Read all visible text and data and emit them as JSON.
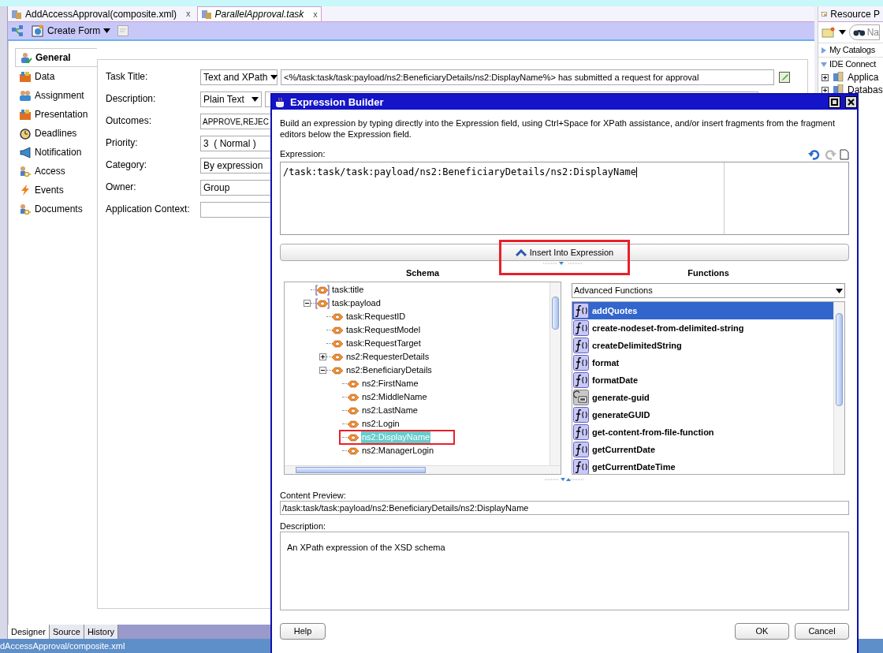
{
  "editor_tabs": [
    {
      "label": "AddAccessApproval(composite.xml)",
      "selected": false,
      "close": "x"
    },
    {
      "label": "ParallelApproval.task",
      "selected": true,
      "close": "x"
    }
  ],
  "toolbar": {
    "create_form": "Create Form"
  },
  "nav": [
    {
      "label": "General",
      "selected": true
    },
    {
      "label": "Data",
      "selected": false
    },
    {
      "label": "Assignment",
      "selected": false
    },
    {
      "label": "Presentation",
      "selected": false
    },
    {
      "label": "Deadlines",
      "selected": false
    },
    {
      "label": "Notification",
      "selected": false
    },
    {
      "label": "Access",
      "selected": false
    },
    {
      "label": "Events",
      "selected": false
    },
    {
      "label": "Documents",
      "selected": false
    }
  ],
  "form": [
    {
      "label": "Task Title:",
      "kind": "select-text",
      "option": "Text and XPath",
      "value": "<%/task:task/task:payload/ns2:BeneficiaryDetails/ns2:DisplayName%> has submitted a request for approval"
    },
    {
      "label": "Description:",
      "kind": "select-text",
      "option": "Plain Text"
    },
    {
      "label": "Outcomes:",
      "kind": "text",
      "value": "APPROVE,REJEC"
    },
    {
      "label": "Priority:",
      "kind": "select",
      "option": "3  ( Normal )"
    },
    {
      "label": "Category:",
      "kind": "select",
      "option": "By expression"
    },
    {
      "label": "Owner:",
      "kind": "select",
      "option": "Group"
    },
    {
      "label": "Application Context:",
      "kind": "text"
    }
  ],
  "bottom_tabs": [
    {
      "label": "Designer",
      "selected": true
    },
    {
      "label": "Source",
      "selected": false
    },
    {
      "label": "History",
      "selected": false
    }
  ],
  "status_bar": "dAccessApproval/composite.xml",
  "resource_panel": {
    "title": "Resource P",
    "search_placeholder": "Na",
    "sections": [
      {
        "label": "My Catalogs",
        "expanded": false
      },
      {
        "label": "IDE Connect",
        "expanded": true,
        "items": [
          "Applica",
          "Databas"
        ]
      }
    ]
  },
  "dialog": {
    "title": "Expression Builder",
    "intro": "Build an expression by typing directly into the Expression field, using Ctrl+Space for XPath assistance, and/or insert fragments from the fragment editors below the Expression field.",
    "expression_label": "Expression:",
    "expression": "/task:task/task:payload/ns2:BeneficiaryDetails/ns2:DisplayName",
    "insert_button": "Insert Into Expression",
    "schema_heading": "Schema",
    "tree": [
      {
        "label": "task:title",
        "kind": "group",
        "selected": false
      },
      {
        "label": "task:payload",
        "kind": "group",
        "selected": false,
        "expanded": true,
        "children": [
          {
            "label": "task:RequestID",
            "kind": "element",
            "selected": false
          },
          {
            "label": "task:RequestModel",
            "kind": "element",
            "selected": false
          },
          {
            "label": "task:RequestTarget",
            "kind": "element",
            "selected": false
          },
          {
            "label": "ns2:RequesterDetails",
            "kind": "element",
            "selected": false,
            "expanded": false
          },
          {
            "label": "ns2:BeneficiaryDetails",
            "kind": "element",
            "selected": false,
            "expanded": true,
            "children": [
              {
                "label": "ns2:FirstName",
                "kind": "element",
                "selected": false
              },
              {
                "label": "ns2:MiddleName",
                "kind": "element",
                "selected": false
              },
              {
                "label": "ns2:LastName",
                "kind": "element",
                "selected": false
              },
              {
                "label": "ns2:Login",
                "kind": "element",
                "selected": false
              },
              {
                "label": "ns2:DisplayName",
                "kind": "element",
                "selected": true
              },
              {
                "label": "ns2:ManagerLogin",
                "kind": "element",
                "selected": false
              }
            ]
          }
        ]
      }
    ],
    "functions_heading": "Functions",
    "functions_category": "Advanced Functions",
    "functions": [
      {
        "label": "addQuotes",
        "kind": "function",
        "selected": true
      },
      {
        "label": "create-nodeset-from-delimited-string",
        "kind": "function",
        "selected": false
      },
      {
        "label": "createDelimitedString",
        "kind": "function",
        "selected": false
      },
      {
        "label": "format",
        "kind": "function",
        "selected": false
      },
      {
        "label": "formatDate",
        "kind": "function",
        "selected": false
      },
      {
        "label": "generate-guid",
        "kind": "generator",
        "selected": false
      },
      {
        "label": "generateGUID",
        "kind": "function",
        "selected": false
      },
      {
        "label": "get-content-from-file-function",
        "kind": "function",
        "selected": false
      },
      {
        "label": "getCurrentDate",
        "kind": "function",
        "selected": false
      },
      {
        "label": "getCurrentDateTime",
        "kind": "function",
        "selected": false
      }
    ],
    "preview_label": "Content Preview:",
    "preview": "/task:task/task:payload/ns2:BeneficiaryDetails/ns2:DisplayName",
    "description_label": "Description:",
    "description": "An XPath expression of the XSD schema",
    "buttons": [
      {
        "label": "Help",
        "kind": "left"
      },
      {
        "label": "OK",
        "kind": "right"
      },
      {
        "label": "Cancel",
        "kind": "right"
      }
    ]
  }
}
